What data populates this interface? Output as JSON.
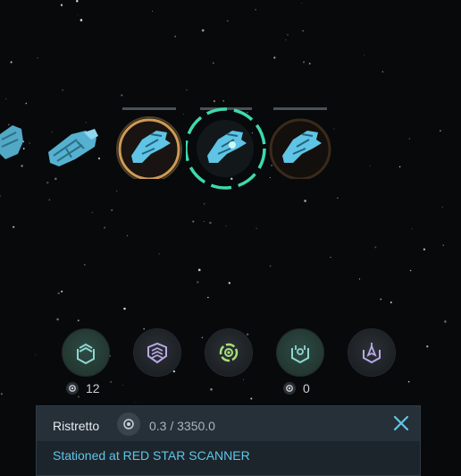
{
  "colors": {
    "ship": "#5fc4e6",
    "selected_ring": "#3ed9ad",
    "active_ring": "#d9a35a",
    "ability_green": "#a7e07a",
    "ability_purple": "#b9a9e6",
    "ability_teal": "#8fd7d0",
    "status_text": "#5ec6e8"
  },
  "fleet": {
    "ships": [
      {
        "icon": "ship-hull-icon",
        "state": "partial"
      },
      {
        "icon": "ship-hull-icon",
        "state": "idle"
      },
      {
        "icon": "ship-icon",
        "state": "active",
        "health_fraction": 1.0
      },
      {
        "icon": "ship-icon",
        "state": "selected",
        "health_fraction": 1.0
      },
      {
        "icon": "ship-icon",
        "state": "dim",
        "health_fraction": 1.0
      }
    ]
  },
  "abilities": [
    {
      "icon": "chevrons-shield-icon",
      "style": "green",
      "count": "12"
    },
    {
      "icon": "layered-shield-icon",
      "style": "dark"
    },
    {
      "icon": "target-gear-icon",
      "style": "dark"
    },
    {
      "icon": "scanner-shield-icon",
      "style": "green",
      "count": "0"
    },
    {
      "icon": "warp-shield-icon",
      "style": "dark"
    }
  ],
  "panel": {
    "ship_name": "Ristretto",
    "cargo": "0.3 / 3350.0",
    "status": "Stationed at RED STAR SCANNER",
    "close_icon": "close-icon"
  }
}
